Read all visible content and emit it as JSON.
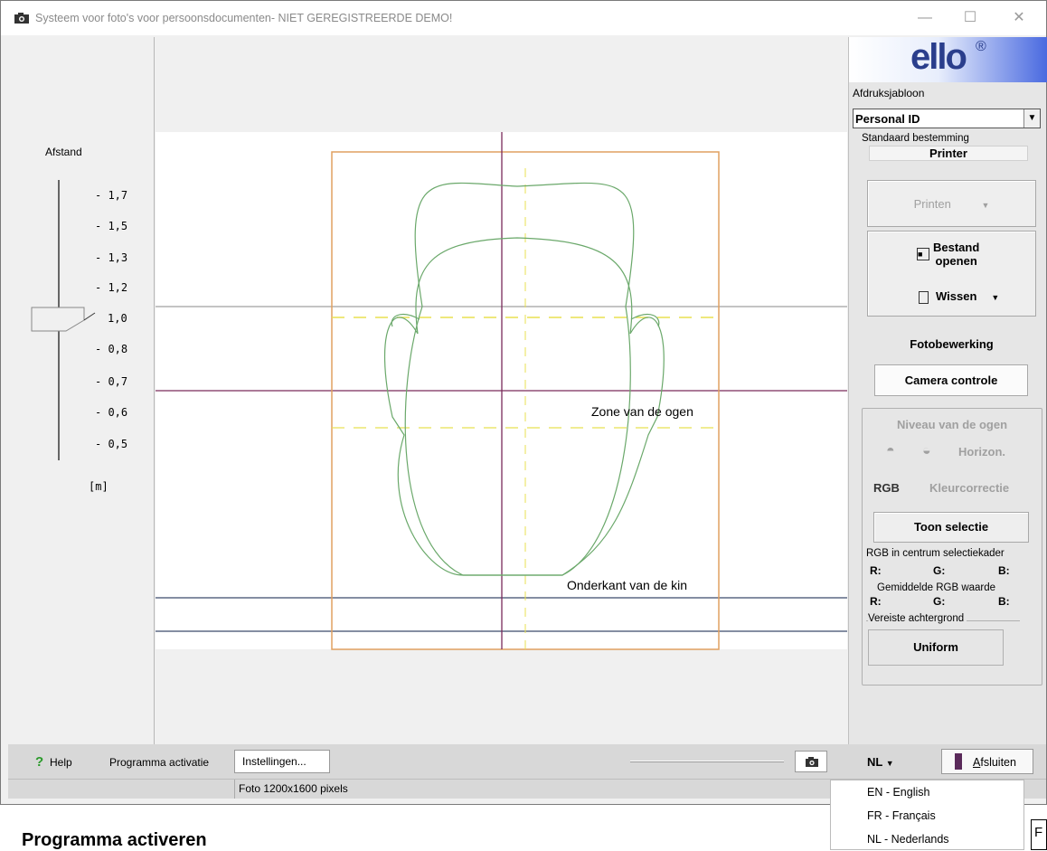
{
  "window": {
    "title": "Systeem voor foto's voor persoonsdocumenten- NIET GEREGISTREERDE DEMO!",
    "minimize": "—",
    "maximize": "☐",
    "close": "✕"
  },
  "distance": {
    "label": "Afstand",
    "ticks": [
      "- 1,7",
      "- 1,5",
      "- 1,3",
      "- 1,2",
      "1,0",
      "- 0,8",
      "- 0,7",
      "- 0,6",
      "- 0,5"
    ],
    "unit": "[m]",
    "current": "1,0"
  },
  "canvas": {
    "eyes_zone_label": "Zone van de ogen",
    "chin_label": "Onderkant van de kin"
  },
  "right": {
    "logo": "ello",
    "logo_mark": "®",
    "template_label": "Afdruksjabloon",
    "template_value": "Personal ID",
    "destination_label": "Standaard bestemming",
    "destination_value": "Printer",
    "print_label": "Printen",
    "open_label_1": "Bestand",
    "open_label_2": "openen",
    "clear_label": "Wissen",
    "photo_edit_label": "Fotobewerking",
    "camera_control_label": "Camera controle",
    "eye_level_label": "Niveau van de ogen",
    "horizon_label": "Horizon.",
    "rgb_label": "RGB",
    "color_correction_label": "Kleurcorrectie",
    "show_selection_label": "Toon selectie",
    "rgb_center_label": "RGB in centrum selectiekader",
    "r": "R:",
    "g": "G:",
    "b": "B:",
    "avg_rgb_label": "Gemiddelde RGB waarde",
    "required_bg_label": "Vereiste achtergrond",
    "required_bg_value": "Uniform"
  },
  "bottom": {
    "help": "Help",
    "activation": "Programma activatie",
    "settings": "Instellingen...",
    "lang": "NL",
    "close": "Afsluiten",
    "close_hotkey": "A",
    "close_rest": "fsluiten"
  },
  "status": {
    "photo_info": "Foto 1200x1600 pixels"
  },
  "language_menu": [
    "EN - English",
    "FR - Français",
    "NL - Nederlands"
  ],
  "below": {
    "heading": "Programma activeren",
    "partial": "F"
  },
  "colors": {
    "frame": "#e0a060",
    "guide_yellow": "#e8e050",
    "face": "#6aa86a",
    "crosshair": "#7a2a5a",
    "line_blue": "#3a4a6a"
  }
}
